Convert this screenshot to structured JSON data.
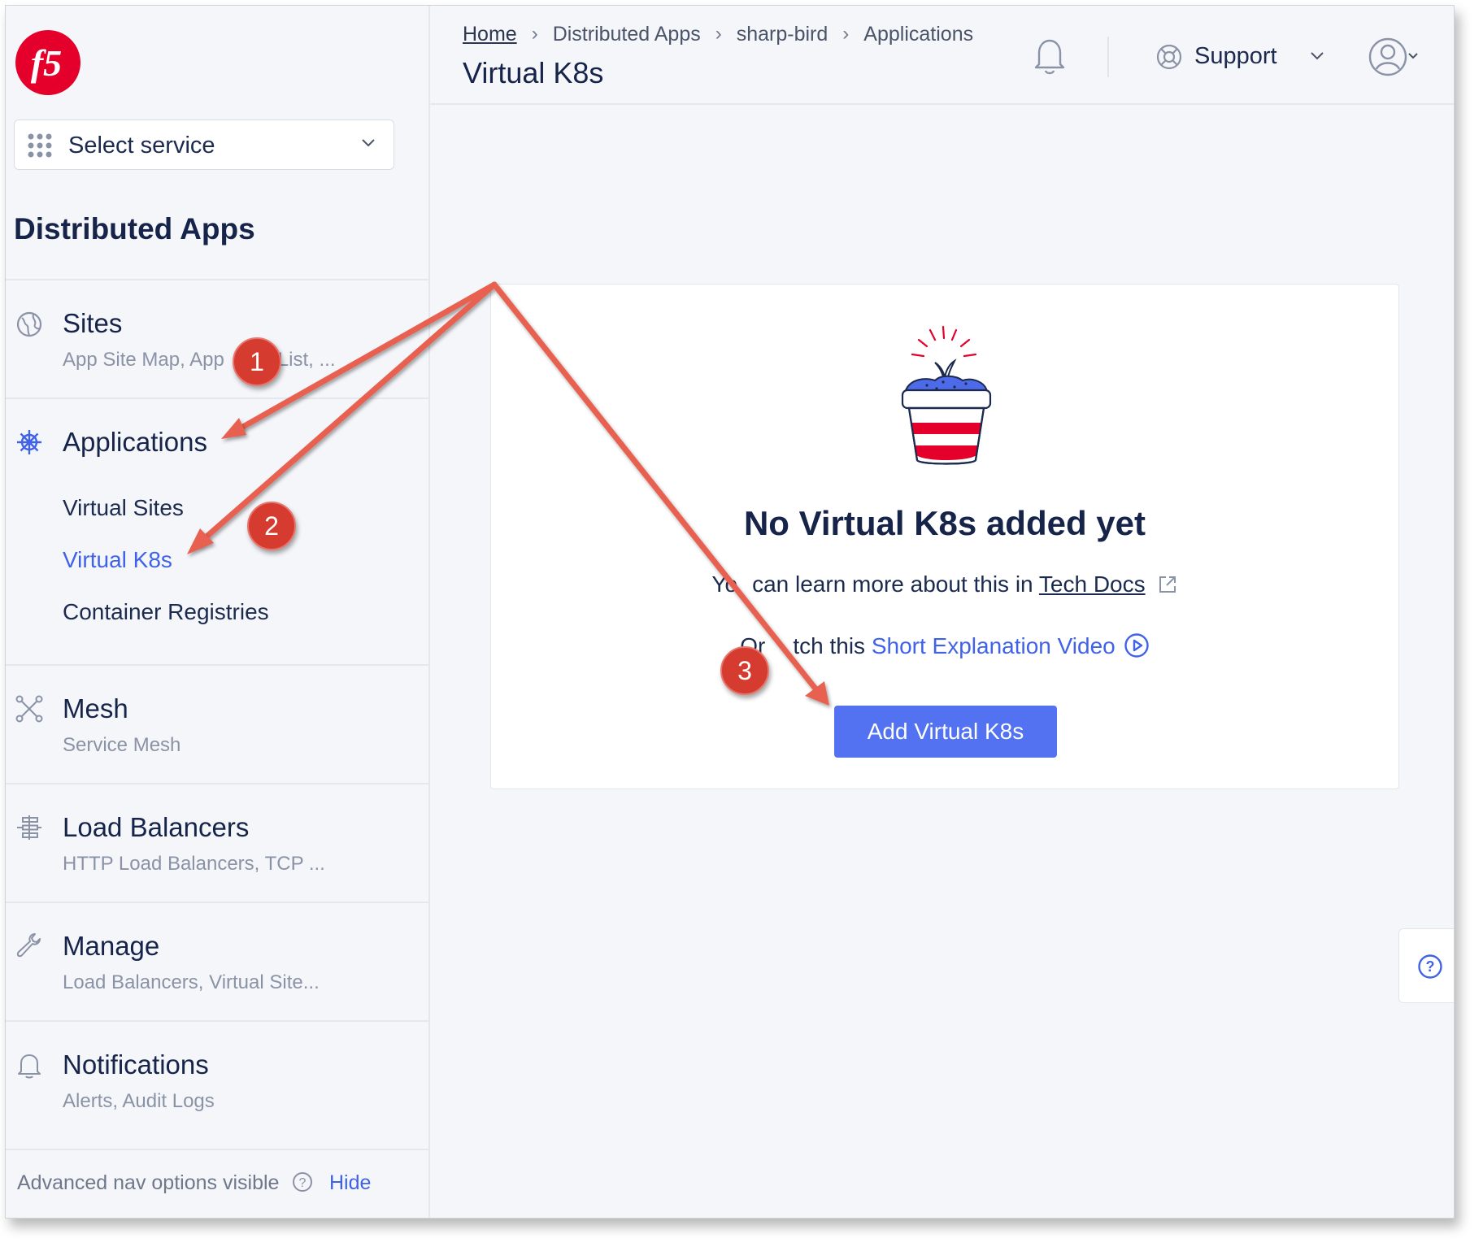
{
  "sidebar": {
    "logo_text": "f5",
    "select_service_label": "Select service",
    "section_title": "Distributed Apps",
    "nav": [
      {
        "title": "Sites",
        "subtitle": "App Site Map, App",
        "subtitle_tail": "List, ...",
        "icon": "globe-icon"
      },
      {
        "title": "Applications",
        "icon": "helm-icon",
        "links": [
          "Virtual Sites",
          "Virtual K8s",
          "Container Registries"
        ],
        "active_link": "Virtual K8s"
      },
      {
        "title": "Mesh",
        "subtitle": "Service Mesh",
        "icon": "mesh-icon"
      },
      {
        "title": "Load Balancers",
        "subtitle": "HTTP Load Balancers, TCP ...",
        "icon": "load-balancer-icon"
      },
      {
        "title": "Manage",
        "subtitle": "Load Balancers, Virtual Site...",
        "icon": "wrench-icon"
      },
      {
        "title": "Notifications",
        "subtitle": "Alerts, Audit Logs",
        "icon": "bell-icon"
      }
    ],
    "footer": {
      "text": "Advanced nav options visible",
      "hide_label": "Hide"
    }
  },
  "header": {
    "breadcrumb": [
      "Home",
      "Distributed Apps",
      "sharp-bird",
      "Applications"
    ],
    "page_title": "Virtual K8s",
    "support_label": "Support"
  },
  "empty_state": {
    "title": "No Virtual K8s added yet",
    "learn_prefix": "Yo",
    "learn_middle": "can learn more about this in",
    "docs_link": "Tech Docs",
    "video_prefix": "Or",
    "video_middle": "tch this",
    "video_link": "Short Explanation Video",
    "button_label": "Add Virtual K8s"
  },
  "annotations": {
    "badges": [
      "1",
      "2",
      "3"
    ],
    "arrow_color": "#e8604f"
  },
  "colors": {
    "accent": "#3f62e8",
    "button": "#5272f2",
    "brand_red": "#e4002b",
    "text_dark": "#16244a"
  }
}
